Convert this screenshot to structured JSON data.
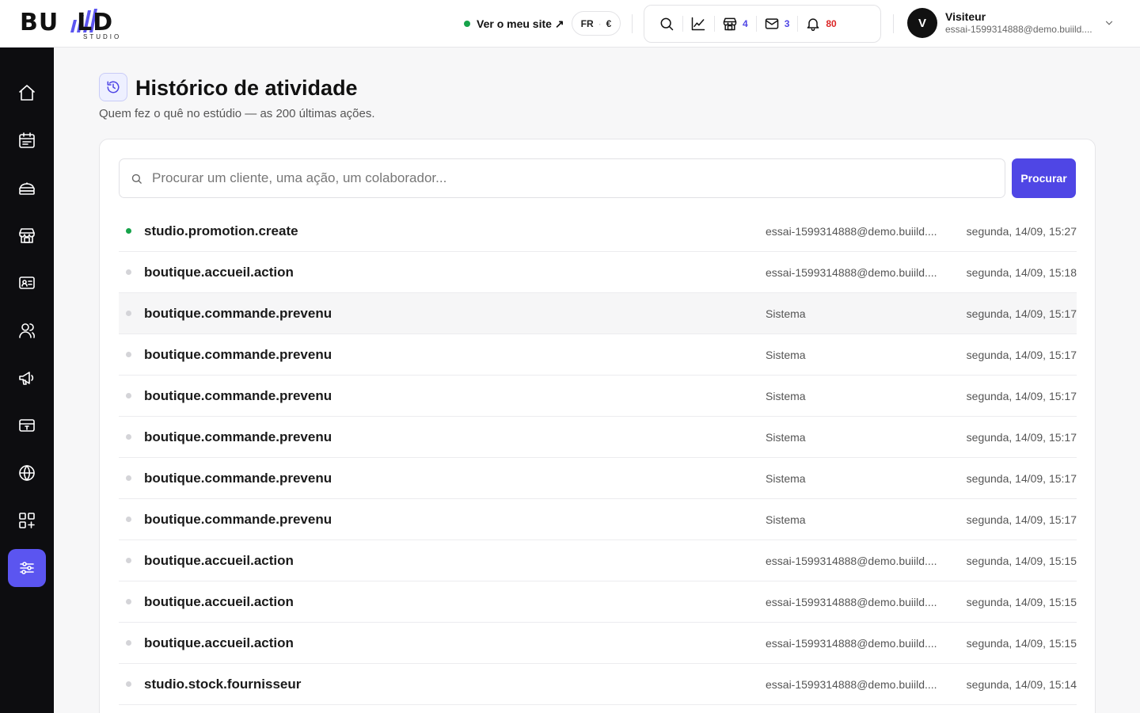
{
  "brand": {
    "logo_main": "BU  LD",
    "logo_sub": "STUDIO"
  },
  "header": {
    "site_link_label": "Ver o meu site ↗",
    "lang": "FR",
    "currency": "€",
    "tools": [
      {
        "icon": "search-icon",
        "count": ""
      },
      {
        "icon": "chart-icon",
        "count": ""
      },
      {
        "icon": "store-icon",
        "count": "4"
      },
      {
        "icon": "mail-icon",
        "count": "3"
      },
      {
        "icon": "bell-icon",
        "count": "80"
      }
    ],
    "user": {
      "initial": "V",
      "name": "Visiteur",
      "email": "essai-1599314888@demo.buiild...."
    }
  },
  "sidebar": {
    "items": [
      {
        "icon": "home-icon"
      },
      {
        "icon": "calendar-icon"
      },
      {
        "icon": "services-icon"
      },
      {
        "icon": "shop-icon"
      },
      {
        "icon": "id-card-icon"
      },
      {
        "icon": "users-icon"
      },
      {
        "icon": "megaphone-icon"
      },
      {
        "icon": "payment-icon"
      },
      {
        "icon": "globe-icon"
      },
      {
        "icon": "apps-icon"
      },
      {
        "icon": "settings-sliders-icon",
        "active": true
      }
    ]
  },
  "main": {
    "title": "Histórico de atividade",
    "subtitle": "Quem fez o quê no estúdio — as 200 últimas ações.",
    "search": {
      "placeholder": "Procurar um cliente, uma ação, um colaborador...",
      "value": "",
      "button_label": "Procurar"
    },
    "rows": [
      {
        "action": "studio.promotion.create",
        "actor": "essai-1599314888@demo.buiild....",
        "when": "segunda, 14/09, 15:27",
        "live": true
      },
      {
        "action": "boutique.accueil.action",
        "actor": "essai-1599314888@demo.buiild....",
        "when": "segunda, 14/09, 15:18"
      },
      {
        "action": "boutique.commande.prevenu",
        "actor": "Sistema",
        "when": "segunda, 14/09, 15:17",
        "highlighted": true
      },
      {
        "action": "boutique.commande.prevenu",
        "actor": "Sistema",
        "when": "segunda, 14/09, 15:17"
      },
      {
        "action": "boutique.commande.prevenu",
        "actor": "Sistema",
        "when": "segunda, 14/09, 15:17"
      },
      {
        "action": "boutique.commande.prevenu",
        "actor": "Sistema",
        "when": "segunda, 14/09, 15:17"
      },
      {
        "action": "boutique.commande.prevenu",
        "actor": "Sistema",
        "when": "segunda, 14/09, 15:17"
      },
      {
        "action": "boutique.commande.prevenu",
        "actor": "Sistema",
        "when": "segunda, 14/09, 15:17"
      },
      {
        "action": "boutique.accueil.action",
        "actor": "essai-1599314888@demo.buiild....",
        "when": "segunda, 14/09, 15:15"
      },
      {
        "action": "boutique.accueil.action",
        "actor": "essai-1599314888@demo.buiild....",
        "when": "segunda, 14/09, 15:15"
      },
      {
        "action": "boutique.accueil.action",
        "actor": "essai-1599314888@demo.buiild....",
        "when": "segunda, 14/09, 15:15"
      },
      {
        "action": "studio.stock.fournisseur",
        "actor": "essai-1599314888@demo.buiild....",
        "when": "segunda, 14/09, 15:14"
      }
    ]
  },
  "colors": {
    "accent": "#4f46e5",
    "sidebar_active": "#5b55f0",
    "live_dot": "#16a34a",
    "alert": "#dc2626"
  }
}
